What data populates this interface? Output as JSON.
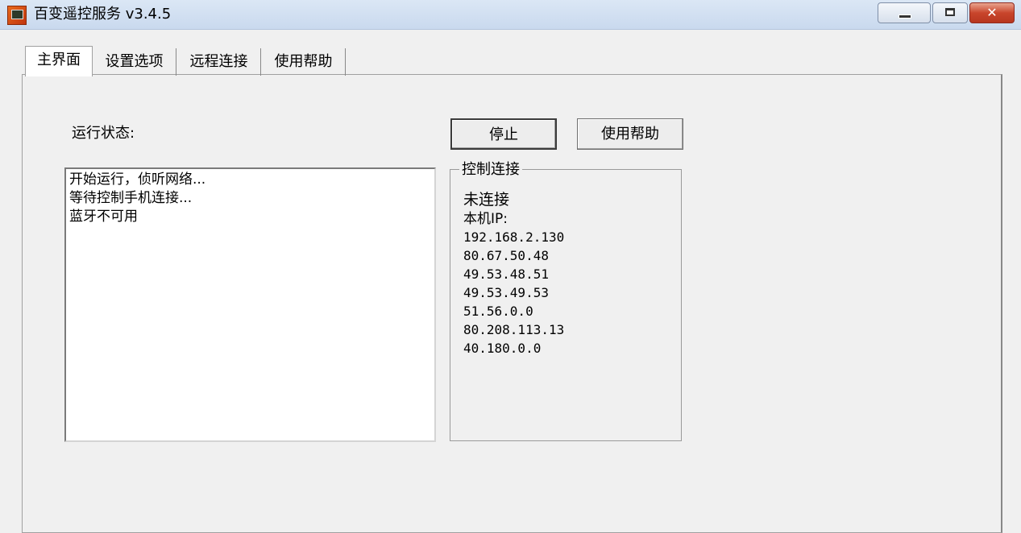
{
  "window": {
    "title": "百变遥控服务 v3.4.5"
  },
  "tabs": [
    {
      "label": "主界面",
      "active": true
    },
    {
      "label": "设置选项",
      "active": false
    },
    {
      "label": "远程连接",
      "active": false
    },
    {
      "label": "使用帮助",
      "active": false
    }
  ],
  "main": {
    "status_label": "运行状态:",
    "log": [
      "开始运行，侦听网络...",
      "等待控制手机连接...",
      "蓝牙不可用"
    ],
    "stop_button": "停止",
    "help_button": "使用帮助",
    "control": {
      "title": "控制连接",
      "status": "未连接",
      "ip_label": "本机IP:",
      "ips": [
        "192.168.2.130",
        "80.67.50.48",
        "49.53.48.51",
        "49.53.49.53",
        "51.56.0.0",
        "80.208.113.13",
        "40.180.0.0"
      ]
    }
  }
}
